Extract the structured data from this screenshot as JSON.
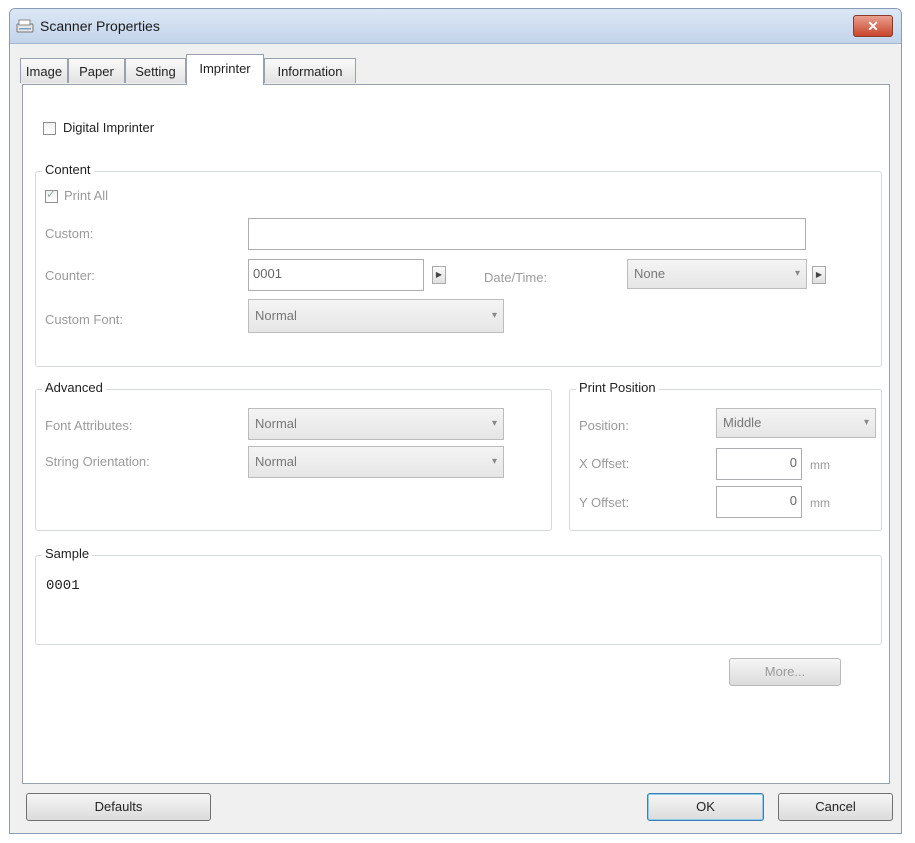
{
  "window": {
    "title": "Scanner Properties",
    "close_label": "✕"
  },
  "tabs": [
    {
      "label": "Image"
    },
    {
      "label": "Paper"
    },
    {
      "label": "Setting"
    },
    {
      "label": "Imprinter",
      "active": true
    },
    {
      "label": "Information"
    }
  ],
  "digital_imprinter": {
    "label": "Digital Imprinter",
    "checked": false
  },
  "content": {
    "title": "Content",
    "print_all": {
      "label": "Print All",
      "checked": true
    },
    "custom_label": "Custom:",
    "custom_value": "",
    "counter_label": "Counter:",
    "counter_value": "0001",
    "datetime_label": "Date/Time:",
    "datetime_value": "None",
    "custom_font_label": "Custom Font:",
    "custom_font_value": "Normal"
  },
  "advanced": {
    "title": "Advanced",
    "font_attributes_label": "Font Attributes:",
    "font_attributes_value": "Normal",
    "string_orientation_label": "String Orientation:",
    "string_orientation_value": "Normal"
  },
  "print_position": {
    "title": "Print Position",
    "position_label": "Position:",
    "position_value": "Middle",
    "x_offset_label": "X Offset:",
    "x_offset_value": "0",
    "y_offset_label": "Y Offset:",
    "y_offset_value": "0",
    "unit": "mm"
  },
  "sample": {
    "title": "Sample",
    "text": "0001"
  },
  "buttons": {
    "more": "More...",
    "defaults": "Defaults",
    "ok": "OK",
    "cancel": "Cancel"
  },
  "icons": {
    "scanner": "scanner-icon",
    "arrow_right": "arrow-right-icon",
    "dropdown": "chevron-down-icon"
  },
  "colors": {
    "title_bar": "#c3d4ea",
    "close_button": "#c9452b",
    "disabled_text": "#9a9a9a"
  }
}
